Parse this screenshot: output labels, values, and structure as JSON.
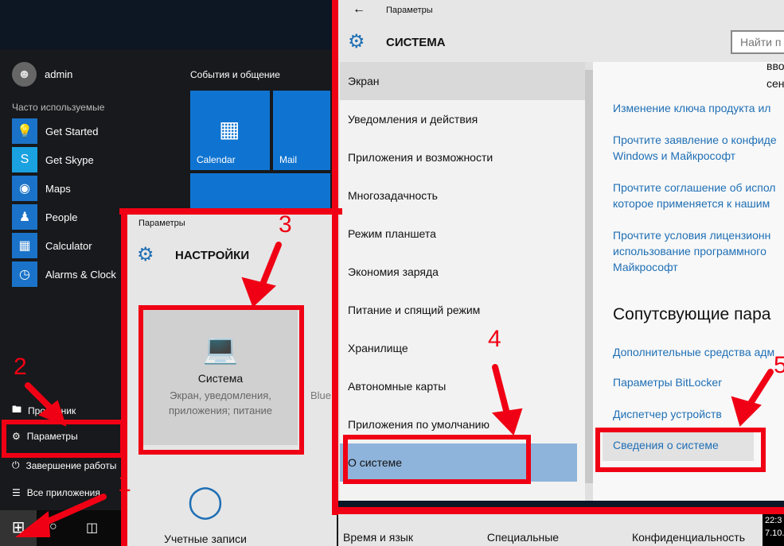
{
  "start_menu": {
    "user": "admin",
    "frequent_label": "Часто используемые",
    "apps": [
      {
        "label": "Get Started",
        "icon": "lightbulb-icon"
      },
      {
        "label": "Get Skype",
        "icon": "skype-icon"
      },
      {
        "label": "Maps",
        "icon": "maps-icon"
      },
      {
        "label": "People",
        "icon": "people-icon"
      },
      {
        "label": "Calculator",
        "icon": "calculator-icon"
      },
      {
        "label": "Alarms & Clock",
        "icon": "alarm-icon"
      }
    ],
    "tiles_group": "События и общение",
    "tiles": [
      "Calendar",
      "Mail"
    ],
    "bottom": [
      {
        "label": "Проводник",
        "icon": "explorer-icon"
      },
      {
        "label": "Параметры",
        "icon": "gear-icon"
      },
      {
        "label": "Завершение работы",
        "icon": "power-icon"
      },
      {
        "label": "Все приложения",
        "icon": "list-icon"
      }
    ]
  },
  "settings_window": {
    "breadcrumb": "Параметры",
    "title": "НАСТРОЙКИ",
    "system_tile": {
      "title": "Система",
      "subtitle": "Экран, уведомления, приложения; питание"
    },
    "partial_tile": "Blue",
    "accounts_tile": "Учетные записи"
  },
  "system_window": {
    "back_label": "Параметры",
    "title": "СИСТЕМА",
    "search_placeholder": "Найти п",
    "nav": [
      "Экран",
      "Уведомления и действия",
      "Приложения и возможности",
      "Многозадачность",
      "Режим планшета",
      "Экономия заряда",
      "Питание и спящий режим",
      "Хранилище",
      "Автономные карты",
      "Приложения по умолчанию",
      "О системе"
    ],
    "selected_nav": "О системе",
    "content_partial": [
      "вво",
      "сен"
    ],
    "links": [
      "Изменение ключа продукта ил",
      "Прочтите заявление о конфиде Windows и Майкрософт",
      "Прочтите соглашение об испол которое применяется к нашим",
      "Прочтите условия лицензионн использование программного Майкрософт"
    ],
    "related_heading": "Сопутсвующие пара",
    "related_links": [
      "Дополнительные средства адм",
      "Параметры BitLocker",
      "Диспетчер устройств",
      "Сведения о системе"
    ]
  },
  "bottom_categories": [
    "Время и язык",
    "Специальные",
    "Конфиденциальность"
  ],
  "clock": {
    "time": "22:3",
    "date": "7.10."
  },
  "annotations": [
    "1",
    "2",
    "3",
    "4",
    "5"
  ],
  "colors": {
    "annotation": "#f00014",
    "accent": "#0f74d1",
    "link": "#1f6fb5",
    "selected": "#8fb4db"
  }
}
